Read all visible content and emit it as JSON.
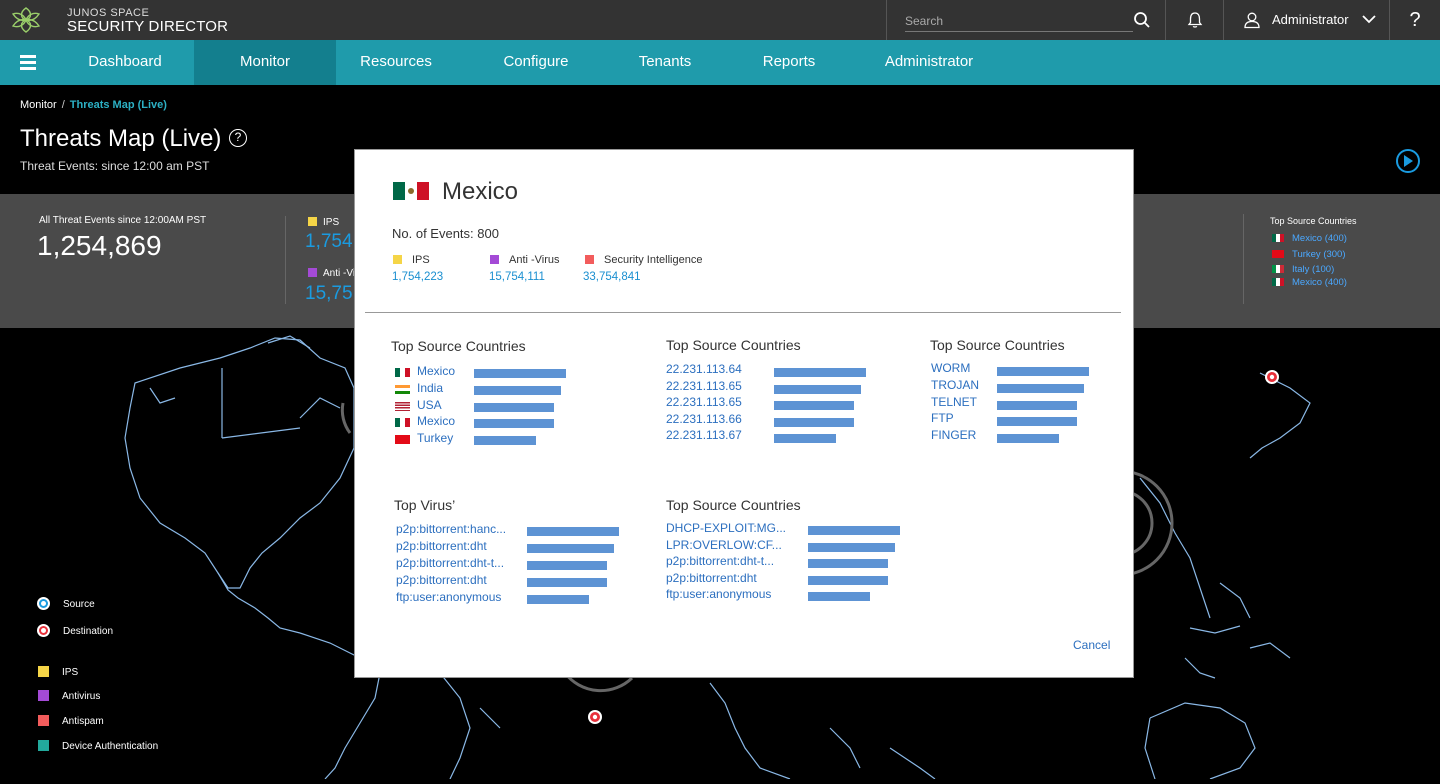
{
  "brand": {
    "line1": "JUNOS SPACE",
    "line2": "SECURITY DIRECTOR"
  },
  "topbar": {
    "search_placeholder": "Search",
    "user_name": "Administrator",
    "help": "?"
  },
  "nav": {
    "items": [
      {
        "label": "Dashboard",
        "active": false
      },
      {
        "label": "Monitor",
        "active": true
      },
      {
        "label": "Resources",
        "active": false
      },
      {
        "label": "Configure",
        "active": false
      },
      {
        "label": "Tenants",
        "active": false
      },
      {
        "label": "Reports",
        "active": false
      },
      {
        "label": "Administrator",
        "active": false
      }
    ]
  },
  "breadcrumb": {
    "parent": "Monitor",
    "separator": "/",
    "current": "Threats Map (Live)"
  },
  "page": {
    "title": "Threats Map (Live)",
    "help": "?",
    "subtitle": "Threat Events: since 12:00 am PST"
  },
  "stats": {
    "total_label": "All Threat Events since 12:00AM PST",
    "total_value": "1,254,869",
    "ips_label": "IPS",
    "ips_value": "1,754",
    "av_label": "Anti -Vi",
    "av_value": "15,75",
    "top_countries_title": "Top Source Countries",
    "top_countries": [
      {
        "name": "Mexico (400)",
        "flag": "mexico-flag-icon"
      },
      {
        "name": "Turkey (300)",
        "flag": "turkey-flag-icon"
      },
      {
        "name": "Italy  (100)",
        "flag": "italy-flag-icon"
      },
      {
        "name": "Mexico (400)",
        "flag": "mexico-flag-icon"
      }
    ]
  },
  "map_legend": {
    "source": "Source",
    "destination": "Destination",
    "ips": "IPS",
    "antivirus": "Antivirus",
    "antispam": "Antispam",
    "device_auth": "Device Authentication"
  },
  "colors": {
    "ips": "#f5d547",
    "antivirus": "#a44ad6",
    "antispam": "#f25c5c",
    "device_auth": "#22a99c",
    "source": "#1a9be0",
    "destination": "#e8303a",
    "accent": "#1f9bab",
    "bar": "#5d93d4"
  },
  "modal": {
    "country": "Mexico",
    "events": "No. of Events: 800",
    "legend": [
      {
        "label": "IPS",
        "value": "1,754,223"
      },
      {
        "label": "Anti -Virus",
        "value": "15,754,111"
      },
      {
        "label": "Security Intelligence",
        "value": "33,754,841"
      }
    ],
    "sections": [
      {
        "title": "Top Source Countries",
        "rows": [
          {
            "label": "Mexico",
            "flag": "mexico-flag-icon",
            "fraction": 1.0
          },
          {
            "label": "India",
            "flag": "india-flag-icon",
            "fraction": 0.95
          },
          {
            "label": "USA",
            "flag": "usa-flag-icon",
            "fraction": 0.87
          },
          {
            "label": "Mexico",
            "flag": "mexico-flag-icon",
            "fraction": 0.87
          },
          {
            "label": "Turkey",
            "flag": "turkey-flag-icon",
            "fraction": 0.67
          }
        ]
      },
      {
        "title": "Top Source Countries",
        "rows": [
          {
            "label": "22.231.113.64",
            "fraction": 1.0
          },
          {
            "label": "22.231.113.65",
            "fraction": 0.95
          },
          {
            "label": "22.231.113.65",
            "fraction": 0.87
          },
          {
            "label": "22.231.113.66",
            "fraction": 0.87
          },
          {
            "label": "22.231.113.67",
            "fraction": 0.67
          }
        ]
      },
      {
        "title": "Top Source Countries",
        "rows": [
          {
            "label": "WORM",
            "fraction": 1.0
          },
          {
            "label": "TROJAN",
            "fraction": 0.95
          },
          {
            "label": "TELNET",
            "fraction": 0.87
          },
          {
            "label": "FTP",
            "fraction": 0.87
          },
          {
            "label": "FINGER",
            "fraction": 0.67
          }
        ]
      },
      {
        "title": "Top Virus’",
        "rows": [
          {
            "label": "p2p:bittorrent:hanc...",
            "fraction": 1.0
          },
          {
            "label": "p2p:bittorrent:dht",
            "fraction": 0.95
          },
          {
            "label": "p2p:bittorrent:dht-t...",
            "fraction": 0.87
          },
          {
            "label": "p2p:bittorrent:dht",
            "fraction": 0.87
          },
          {
            "label": "ftp:user:anonymous",
            "fraction": 0.67
          }
        ]
      },
      {
        "title": "Top Source Countries",
        "rows": [
          {
            "label": "DHCP-EXPLOIT:MG...",
            "fraction": 1.0
          },
          {
            "label": "LPR:OVERLOW:CF...",
            "fraction": 0.95
          },
          {
            "label": "p2p:bittorrent:dht-t...",
            "fraction": 0.87
          },
          {
            "label": "p2p:bittorrent:dht",
            "fraction": 0.87
          },
          {
            "label": "ftp:user:anonymous",
            "fraction": 0.67
          }
        ]
      }
    ],
    "cancel_label": "Cancel"
  }
}
